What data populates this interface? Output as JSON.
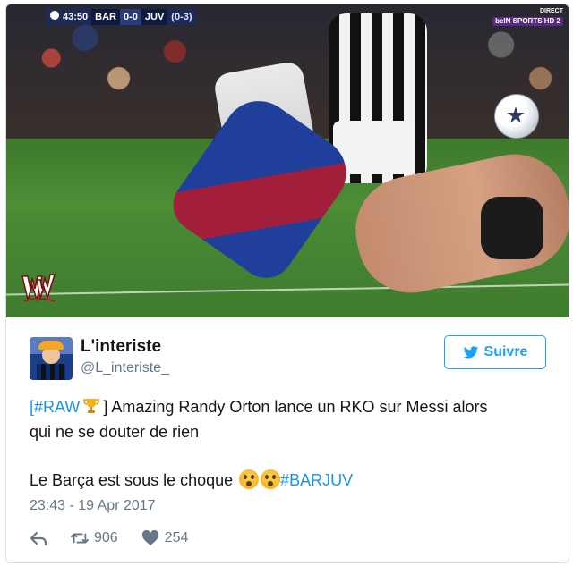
{
  "media": {
    "scorebug": {
      "time": "43:50",
      "home": "BAR",
      "score": "0-0",
      "away": "JUV",
      "aggregate": "(0-3)"
    },
    "broadcaster": {
      "top": "DIRECT",
      "logo": "beIN SPORTS HD 2"
    },
    "watermark_icon": "wwe-logo-icon"
  },
  "tweet": {
    "name": "L'interiste",
    "handle": "@L_interiste_",
    "follow_label": "Suivre",
    "text": {
      "l1_hashtag": "[#RAW",
      "l1_rest": "] Amazing Randy Orton lance un RKO sur Messi alors",
      "l2": "qui ne se douter de rien",
      "l3_text": "Le Barça est sous le choque ",
      "l3_hashtag": "#BARJUV"
    },
    "timestamp": "23:43 - 19 Apr 2017",
    "retweets": "906",
    "likes": "254"
  },
  "colors": {
    "accent": "#1da1f2",
    "hashtag": "#1b95e0",
    "muted": "#657786",
    "text": "#14171a"
  }
}
